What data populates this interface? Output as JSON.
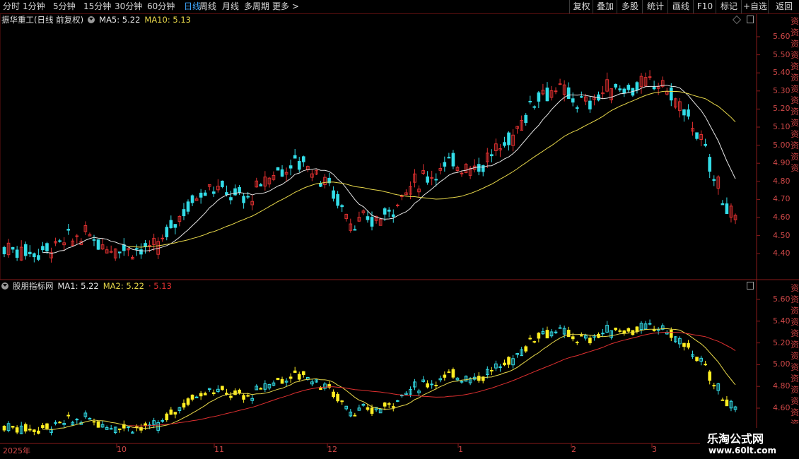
{
  "toolbar": {
    "periods": [
      "分时",
      "1分钟",
      "5分钟",
      "15分钟",
      "30分钟",
      "60分钟",
      "日线",
      "周线",
      "月线",
      "多周期",
      "更多"
    ],
    "more_arrow": ">",
    "active": "日线",
    "buttons": [
      "复权",
      "叠加",
      "多股",
      "统计",
      "画线",
      "F10",
      "标记",
      "+自选",
      "返回"
    ]
  },
  "main_panel": {
    "stock_name": "振华重工(日线 前复权)",
    "ma5_label": "MA5: 5.22",
    "ma10_label": "MA10: 5.13",
    "y_ticks": [
      "5.60",
      "5.50",
      "5.40",
      "5.30",
      "5.20",
      "5.10",
      "5.00",
      "4.90",
      "4.80",
      "4.70",
      "4.60",
      "4.50",
      "4.40"
    ],
    "colors": {
      "up": "#e03030",
      "down": "#33dde8",
      "ma5": "#e6e6e6",
      "ma10": "#e8d84a"
    }
  },
  "sub_panel": {
    "indicator_name": "股朋指标网",
    "ma1_label": "MA1: 5.22",
    "ma2_label": "MA2: 5.22",
    "extra_label": "· 5.13",
    "y_ticks": [
      "5.60",
      "5.40",
      "5.20",
      "5.00",
      "4.80",
      "4.60"
    ],
    "colors": {
      "up": "#33dde8",
      "down": "#ffee22",
      "green": "#33cc33",
      "ma1": "#e8d84a",
      "ma2": "#e03030"
    }
  },
  "x_axis": {
    "labels": [
      "2025年",
      "10",
      "11",
      "12",
      "1",
      "2",
      "3"
    ]
  },
  "watermark": {
    "line1": "乐淘公式网",
    "line2": "www.60lt.com"
  },
  "side_text": "资资资资资资资资资资资资资资"
}
